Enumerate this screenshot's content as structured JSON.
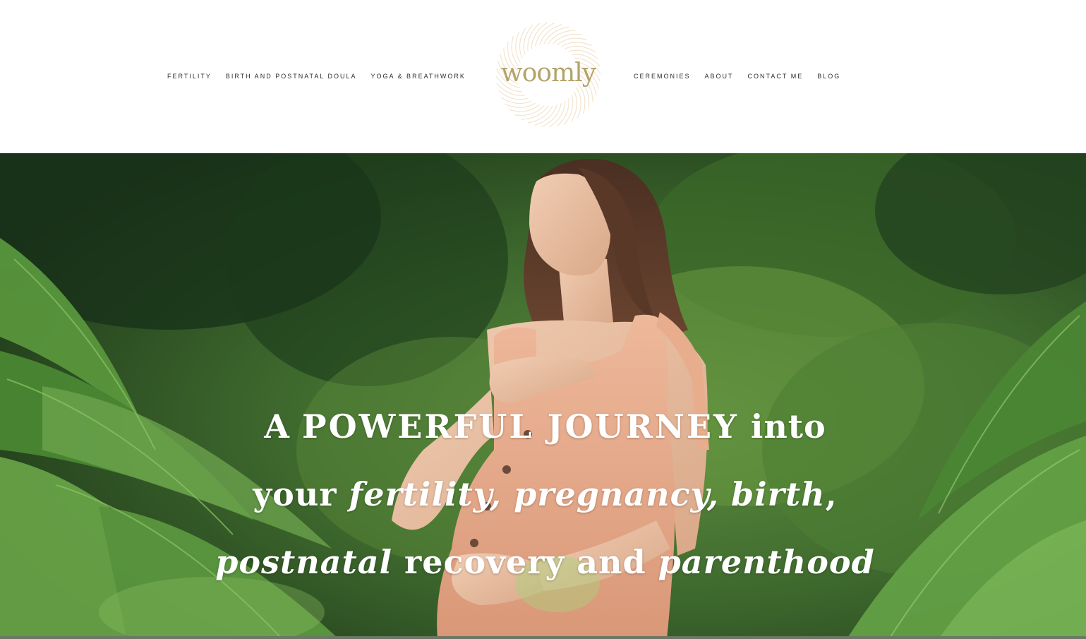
{
  "brand": {
    "logo_text": "woomly",
    "accent_color": "#b3a36a",
    "logo_ring_color": "#f3e4cf"
  },
  "nav": {
    "left": [
      "FERTILITY",
      "BIRTH AND POSTNATAL DOULA",
      "YOGA & BREATHWORK"
    ],
    "right": [
      "CEREMONIES",
      "ABOUT",
      "CONTACT ME",
      "BLOG"
    ]
  },
  "hero": {
    "image": "pregnant woman with eyes closed, hand on chest, standing among ferns in a forest",
    "headline": {
      "line1": {
        "a": "A ",
        "b": "POWERFUL JOURNEY",
        "c": " into"
      },
      "line2": {
        "a": "your ",
        "b": "fertility, pregnancy, ",
        "c": "birth",
        "d": ","
      },
      "line3": {
        "a": "postnatal",
        "b": " recovery and ",
        "c": "parenthood"
      }
    }
  }
}
